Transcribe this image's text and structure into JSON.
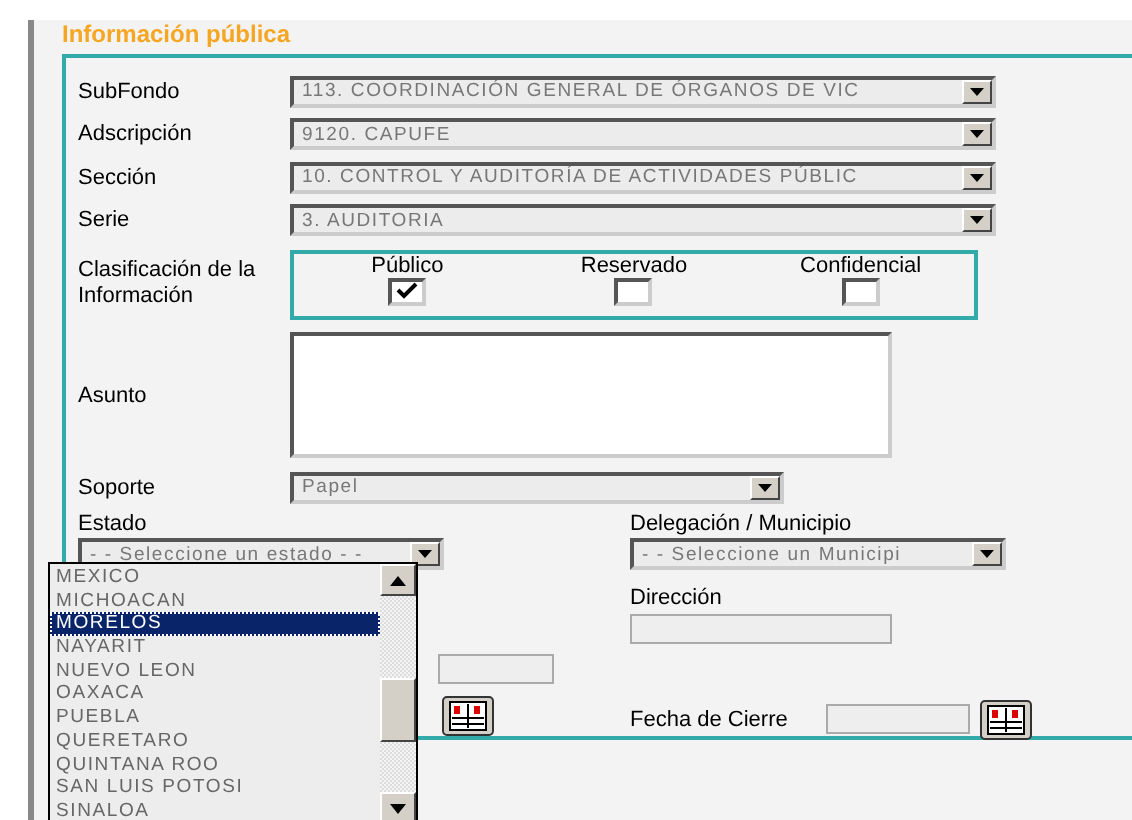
{
  "section_title": "Información pública",
  "selects": [
    {
      "label": "SubFondo",
      "value": "113. COORDINACIÓN GENERAL DE ÓRGANOS DE VIC"
    },
    {
      "label": "Adscripción",
      "value": "9120. CAPUFE"
    },
    {
      "label": "Sección",
      "value": "10. CONTROL Y AUDITORÍA DE ACTIVIDADES PÚBLIC"
    },
    {
      "label": "Serie",
      "value": "3. AUDITORIA"
    }
  ],
  "classification": {
    "label": "Clasificación de la Información",
    "options": [
      {
        "label": "Público",
        "checked": true
      },
      {
        "label": "Reservado",
        "checked": false
      },
      {
        "label": "Confidencial",
        "checked": false
      }
    ]
  },
  "asunto": {
    "label": "Asunto"
  },
  "soporte": {
    "label": "Soporte",
    "value": "Papel"
  },
  "estado": {
    "label": "Estado",
    "value": "- - Seleccione un estado - -",
    "expanded": true,
    "options": [
      {
        "label": "MEXICO",
        "selected": false
      },
      {
        "label": "MICHOACAN",
        "selected": false
      },
      {
        "label": "MORELOS",
        "selected": true
      },
      {
        "label": "NAYARIT",
        "selected": false
      },
      {
        "label": "NUEVO LEON",
        "selected": false
      },
      {
        "label": "OAXACA",
        "selected": false
      },
      {
        "label": "PUEBLA",
        "selected": false
      },
      {
        "label": "QUERETARO",
        "selected": false
      },
      {
        "label": "QUINTANA ROO",
        "selected": false
      },
      {
        "label": "SAN LUIS POTOSI",
        "selected": false
      },
      {
        "label": "SINALOA",
        "selected": false
      }
    ]
  },
  "municipio": {
    "label": "Delegación / Municipio",
    "value": "- - Seleccione un Municipi"
  },
  "direccion": {
    "label": "Dirección"
  },
  "fecha_cierre": {
    "label": "Fecha de Cierre"
  }
}
